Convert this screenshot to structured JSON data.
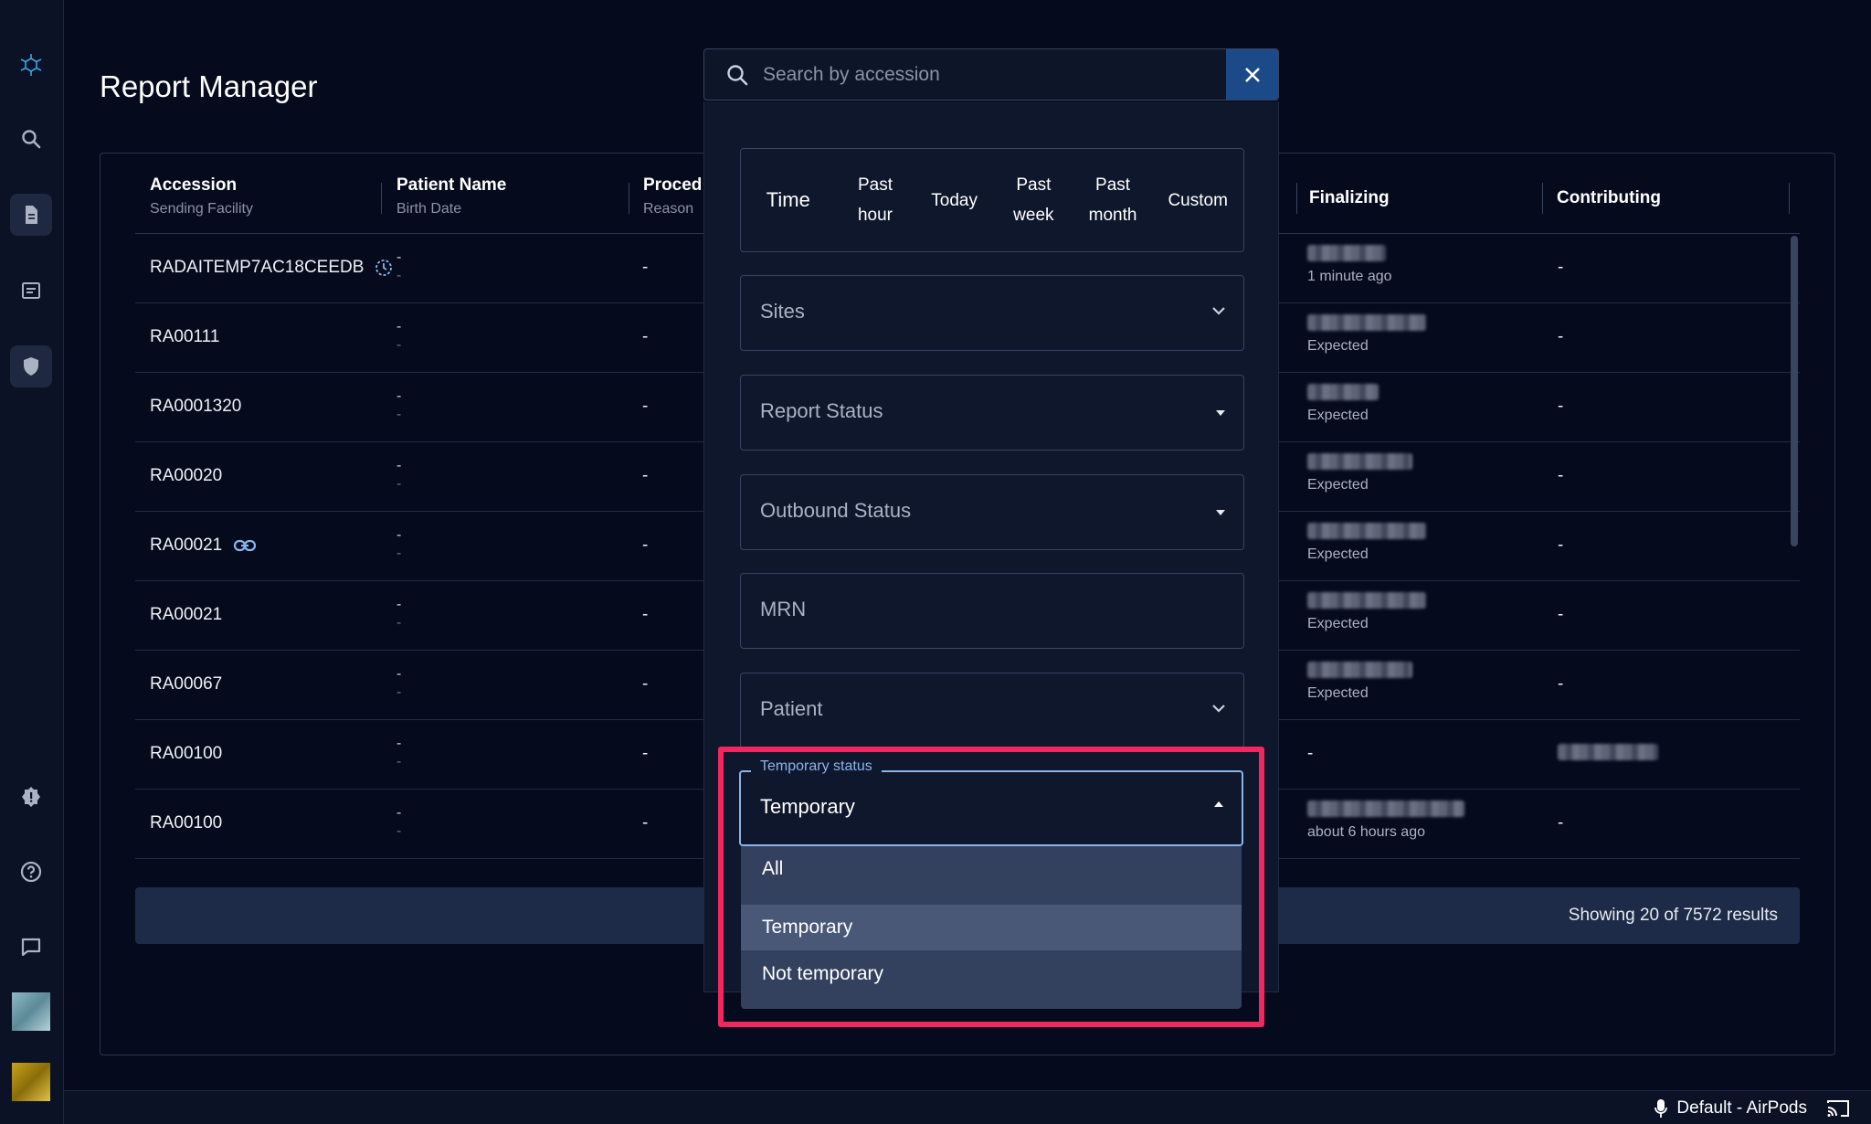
{
  "app": {
    "title": "Report Manager"
  },
  "sidebar": {
    "items": [
      {
        "icon": "logo-icon"
      },
      {
        "icon": "search-icon"
      },
      {
        "icon": "document-icon"
      },
      {
        "icon": "report-list-icon"
      },
      {
        "icon": "shield-icon"
      },
      {
        "icon": "alert-badge-icon"
      },
      {
        "icon": "help-icon"
      },
      {
        "icon": "chat-icon"
      }
    ]
  },
  "table": {
    "columns": [
      {
        "label": "Accession",
        "sub": "Sending Facility"
      },
      {
        "label": "Patient Name",
        "sub": "Birth Date"
      },
      {
        "label": "Proced",
        "sub": "Reason"
      },
      {
        "label": "Finalizing",
        "sub": ""
      },
      {
        "label": "Contributing",
        "sub": ""
      }
    ],
    "rows": [
      {
        "accession": "RADAITEMP7AC18CEEDB",
        "icon": "temporary-clock-icon",
        "patient": "-",
        "sub": "-",
        "proc": "-",
        "fin_sub": "1 minute ago",
        "contrib": "-"
      },
      {
        "accession": "RA00111",
        "icon": "",
        "patient": "-",
        "sub": "-",
        "proc": "-",
        "fin_sub": "Expected",
        "contrib": "-"
      },
      {
        "accession": "RA0001320",
        "icon": "",
        "patient": "-",
        "sub": "-",
        "proc": "-",
        "fin_sub": "Expected",
        "contrib": "-"
      },
      {
        "accession": "RA00020",
        "icon": "",
        "patient": "-",
        "sub": "-",
        "proc": "-",
        "fin_sub": "Expected",
        "contrib": "-"
      },
      {
        "accession": "RA00021",
        "icon": "link-icon",
        "patient": "-",
        "sub": "-",
        "proc": "-",
        "fin_sub": "Expected",
        "contrib": "-"
      },
      {
        "accession": "RA00021",
        "icon": "",
        "patient": "-",
        "sub": "-",
        "proc": "-",
        "fin_sub": "Expected",
        "contrib": "-"
      },
      {
        "accession": "RA00067",
        "icon": "",
        "patient": "-",
        "sub": "-",
        "proc": "-",
        "fin_sub": "Expected",
        "contrib": "-"
      },
      {
        "accession": "RA00100",
        "icon": "",
        "patient": "-",
        "sub": "-",
        "proc": "-",
        "fin_sub": "-",
        "contrib": ""
      },
      {
        "accession": "RA00100",
        "icon": "",
        "patient": "-",
        "sub": "-",
        "proc": "-",
        "fin_sub": "about 6 hours ago",
        "contrib": "-"
      }
    ],
    "results": "Showing 20 of 7572 results"
  },
  "search": {
    "placeholder": "Search by accession"
  },
  "filters": {
    "time_label": "Time",
    "time_options": [
      "Past hour",
      "Today",
      "Past week",
      "Past month",
      "Custom"
    ],
    "sites": "Sites",
    "report_status": "Report Status",
    "outbound_status": "Outbound Status",
    "mrn": "MRN",
    "patient": "Patient",
    "temporary_status": {
      "label": "Temporary status",
      "value": "Temporary",
      "options": [
        "All",
        "Temporary",
        "Not temporary"
      ],
      "selected": "Temporary"
    }
  },
  "statusbar": {
    "audio": "Default - AirPods"
  },
  "colors": {
    "background": "#050a1c",
    "accent": "#1c4a88",
    "highlight": "#f0285f",
    "focus": "#8ab4ec"
  }
}
